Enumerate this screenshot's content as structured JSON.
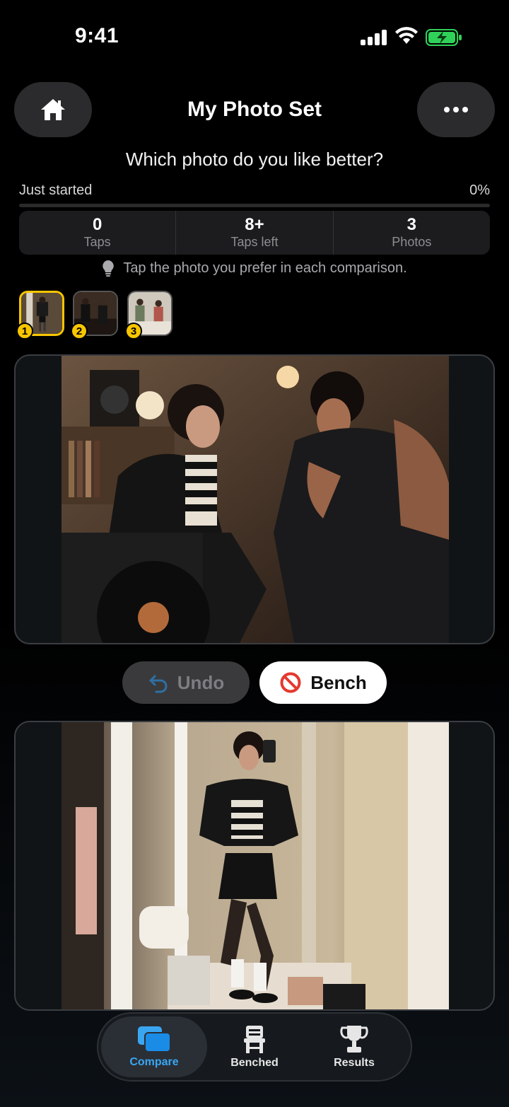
{
  "status_bar": {
    "time": "9:41"
  },
  "header": {
    "title": "My Photo Set"
  },
  "prompt": {
    "question": "Which photo do you like better?"
  },
  "progress": {
    "label": "Just started",
    "percent_text": "0%",
    "fraction": 0.0
  },
  "stats": [
    {
      "value": "0",
      "label": "Taps"
    },
    {
      "value": "8+",
      "label": "Taps left"
    },
    {
      "value": "3",
      "label": "Photos"
    }
  ],
  "hint": {
    "icon": "lightbulb-icon",
    "text": "Tap the photo you prefer in each comparison."
  },
  "thumbnails": [
    {
      "badge": "1",
      "selected": true
    },
    {
      "badge": "2",
      "selected": false
    },
    {
      "badge": "3",
      "selected": false
    }
  ],
  "actions": {
    "undo_label": "Undo",
    "bench_label": "Bench"
  },
  "tabs": [
    {
      "label": "Compare",
      "icon": "compare-icon",
      "active": true
    },
    {
      "label": "Benched",
      "icon": "chair-icon",
      "active": false
    },
    {
      "label": "Results",
      "icon": "trophy-icon",
      "active": false
    }
  ],
  "colors": {
    "accent": "#3aa6f2",
    "badge": "#f7c600",
    "battery": "#30d158",
    "bench_icon": "#e5382f"
  }
}
